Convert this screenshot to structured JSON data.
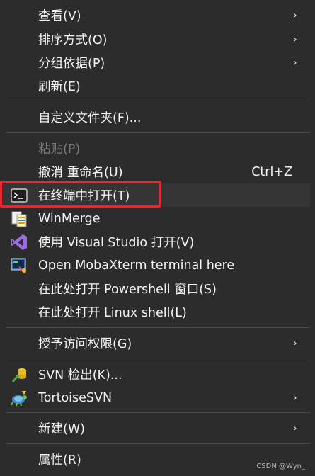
{
  "menu": {
    "items": [
      {
        "label": "查看(V)"
      },
      {
        "label": "排序方式(O)"
      },
      {
        "label": "分组依据(P)"
      },
      {
        "label": "刷新(E)"
      },
      {
        "label": "自定义文件夹(F)..."
      },
      {
        "label": "粘贴(P)"
      },
      {
        "label": "撤消 重命名(U)",
        "shortcut": "Ctrl+Z"
      },
      {
        "label": "在终端中打开(T)"
      },
      {
        "label": "WinMerge"
      },
      {
        "label": "使用 Visual Studio 打开(V)"
      },
      {
        "label": "Open MobaXterm terminal here"
      },
      {
        "label": "在此处打开 Powershell 窗口(S)"
      },
      {
        "label": "在此处打开 Linux shell(L)"
      },
      {
        "label": "授予访问权限(G)"
      },
      {
        "label": "SVN 检出(K)..."
      },
      {
        "label": "TortoiseSVN"
      },
      {
        "label": "新建(W)"
      },
      {
        "label": "属性(R)"
      }
    ],
    "submenu_arrow": "›"
  },
  "icons": {
    "terminal": "terminal-icon",
    "winmerge": "winmerge-icon",
    "visualstudio": "visual-studio-icon",
    "mobaxterm": "mobaxterm-icon",
    "svn_checkout": "svn-checkout-icon",
    "tortoisesvn": "tortoisesvn-icon"
  },
  "colors": {
    "highlight_border": "#e8262f"
  },
  "watermark": "CSDN @Wyn_"
}
